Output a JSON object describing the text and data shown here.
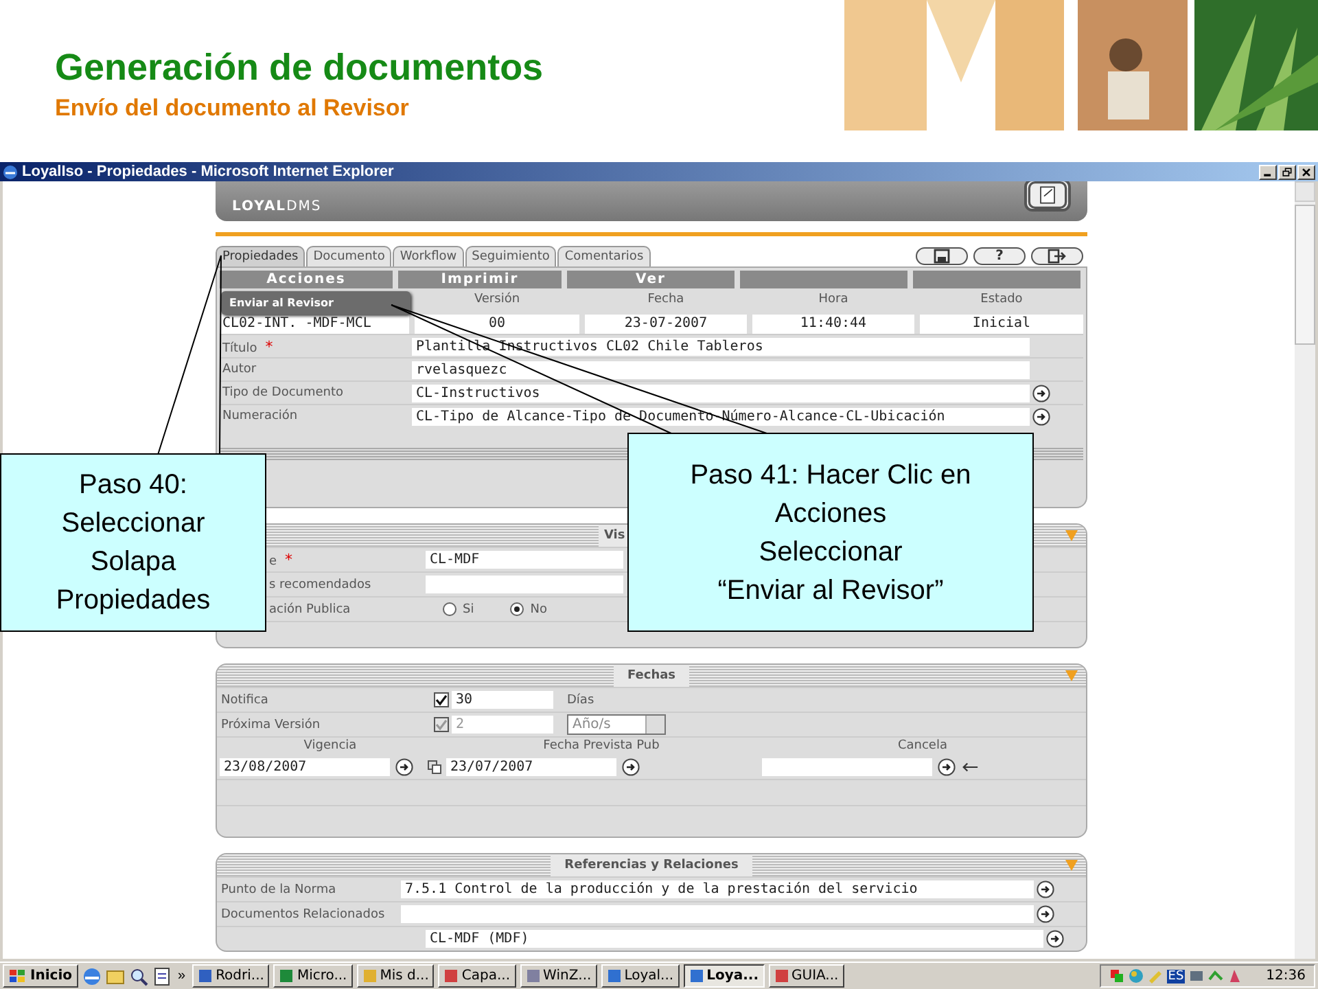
{
  "slide": {
    "title": "Generación de documentos",
    "subtitle": "Envío del documento al Revisor"
  },
  "window": {
    "title": "LoyalIso - Propiedades - Microsoft Internet Explorer"
  },
  "app": {
    "brand": "**LOYAL**DMS",
    "tabs": [
      {
        "label": "Propiedades",
        "selected": true
      },
      {
        "label": "Documento",
        "selected": false
      },
      {
        "label": "Workflow",
        "selected": false
      },
      {
        "label": "Seguimiento",
        "selected": false
      },
      {
        "label": "Comentarios",
        "selected": false
      }
    ],
    "tools": [
      {
        "kind": "save"
      },
      {
        "label": "?",
        "kind": "help"
      },
      {
        "kind": "exit"
      }
    ],
    "actions": [
      {
        "kind": "button",
        "label": "Acciones"
      },
      {
        "kind": "button",
        "label": "Imprimir"
      },
      {
        "kind": "button",
        "label": "Ver"
      },
      {
        "kind": "blank"
      },
      {
        "kind": "blank"
      }
    ],
    "menu": {
      "items": [
        "Enviar al Revisor"
      ]
    },
    "info": {
      "code": "CL02-INT. -MDF-MCL",
      "columns": [
        {
          "label": "Versión",
          "value": "00"
        },
        {
          "label": "Fecha",
          "value": "23-07-2007"
        },
        {
          "label": "Hora",
          "value": "11:40:44"
        },
        {
          "label": "Estado",
          "value": "Inicial"
        }
      ]
    },
    "properties": [
      {
        "label": "Título",
        "mark": "*",
        "value": "Plantilla Instructivos CL02 Chile Tableros"
      },
      {
        "label": "Autor",
        "value": "rvelasquezc"
      },
      {
        "label": "Tipo de Documento",
        "value": "CL-Instructivos",
        "lookup": true
      },
      {
        "label": "Numeración",
        "value": "CL-Tipo de Alcance-Tipo de Documento-Número-Alcance-CL-Ubicación",
        "lookup": true
      }
    ],
    "visibility": {
      "title": "Vis",
      "rows": [
        {
          "kind": "text",
          "label": "e",
          "mark": "*",
          "value": "CL-MDF"
        },
        {
          "kind": "text",
          "label": "s recomendados"
        },
        {
          "kind": "radio",
          "label": "ación Publica",
          "options": [
            {
              "label": "Si",
              "selected": false
            },
            {
              "label": "No",
              "selected": true
            }
          ]
        }
      ]
    },
    "dates": {
      "title": "Fechas",
      "notify": {
        "label": "Notifica",
        "checked": true,
        "disabled": false,
        "value": "30",
        "unit": "Días"
      },
      "next_version": {
        "label": "Próxima Versión",
        "checked": true,
        "disabled": true,
        "value": "2",
        "unit": "Año/s"
      },
      "columns": [
        {
          "label": "Vigencia",
          "value": "23/08/2007",
          "copy": true
        },
        {
          "label": "Fecha Prevista Pub",
          "value": "23/07/2007"
        },
        {
          "label": "Cancela",
          "back": true
        }
      ]
    },
    "references": {
      "title": "Referencias y Relaciones",
      "rows": [
        {
          "label": "Punto de la Norma",
          "value": "7.5.1 Control de la producción y de la prestación del servicio"
        },
        {
          "label": "Documentos Relacionados"
        },
        {
          "value": "CL-MDF (MDF)"
        }
      ]
    }
  },
  "callouts": [
    {
      "lines": [
        "Paso 40:",
        "Seleccionar",
        "Solapa",
        "Propiedades"
      ]
    },
    {
      "lines": [
        "Paso 41: Hacer Clic en",
        "Acciones",
        "Seleccionar",
        "“Enviar al Revisor”"
      ]
    }
  ],
  "taskbar": {
    "start": "Inicio",
    "more": "»",
    "tasks": [
      {
        "label": "Rodri...",
        "selected": false,
        "color": "#3060c0"
      },
      {
        "label": "Micro...",
        "selected": false,
        "color": "#1e8a3a"
      },
      {
        "label": "Mis d...",
        "selected": false,
        "color": "#e0b030"
      },
      {
        "label": "Capa...",
        "selected": false,
        "color": "#d04040"
      },
      {
        "label": "WinZ...",
        "selected": false,
        "color": "#8080a0"
      },
      {
        "label": "Loyal...",
        "selected": false,
        "color": "#3070d0"
      },
      {
        "label": "Loya...",
        "selected": true,
        "color": "#3070d0"
      },
      {
        "label": "GUIA...",
        "selected": false,
        "color": "#d04040"
      }
    ],
    "language": "ES",
    "clock": "12:36"
  }
}
